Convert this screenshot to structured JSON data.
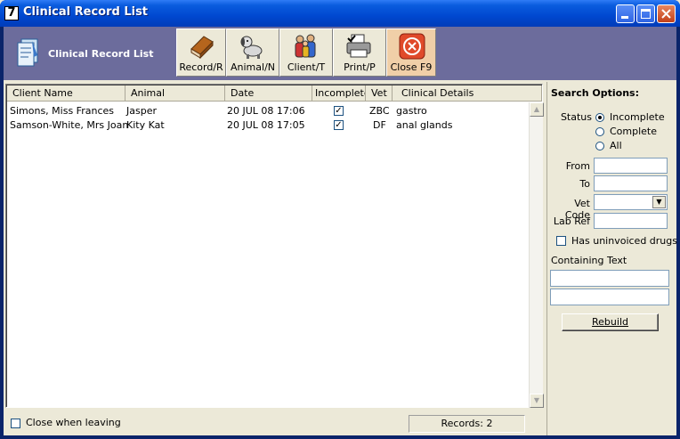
{
  "window": {
    "title": "Clinical Record List",
    "app_icon": "7"
  },
  "header": {
    "title": "Clinical Record List"
  },
  "toolbar": [
    {
      "label": "Record/R",
      "icon": "record-book-icon"
    },
    {
      "label": "Animal/N",
      "icon": "dog-icon"
    },
    {
      "label": "Client/T",
      "icon": "people-icon"
    },
    {
      "label": "Print/P",
      "icon": "printer-icon"
    },
    {
      "label": "Close F9",
      "icon": "close-circle-icon"
    }
  ],
  "list": {
    "columns": [
      "Client Name",
      "Animal",
      "Date",
      "Incomplete",
      "Vet",
      "Clinical Details"
    ],
    "rows": [
      {
        "client": "Simons, Miss Frances",
        "animal": "Jasper",
        "date": "20 JUL 08  17:06",
        "incomplete": "✓",
        "vet": "ZBC",
        "details": "gastro"
      },
      {
        "client": "Samson-White, Mrs Joan",
        "animal": "Kity Kat",
        "date": "20 JUL 08  17:05",
        "incomplete": "✓",
        "vet": "DF",
        "details": "anal glands"
      }
    ]
  },
  "footer": {
    "close_when_leaving": "Close when leaving",
    "records": "Records: 2"
  },
  "search": {
    "title": "Search Options:",
    "status_label": "Status",
    "status_options": [
      "Incomplete",
      "Complete",
      "All"
    ],
    "status_selected": "Incomplete",
    "from_label": "From",
    "to_label": "To",
    "vet_code_label": "Vet Code",
    "lab_ref_label": "Lab Ref",
    "uninvoiced_label": "Has uninvoiced drugs",
    "containing_label": "Containing Text",
    "rebuild_label": "Rebuild"
  },
  "colors": {
    "header_bg": "#6C6C9C",
    "titlebar": "#0048D0",
    "face": "#ECE9D8"
  }
}
